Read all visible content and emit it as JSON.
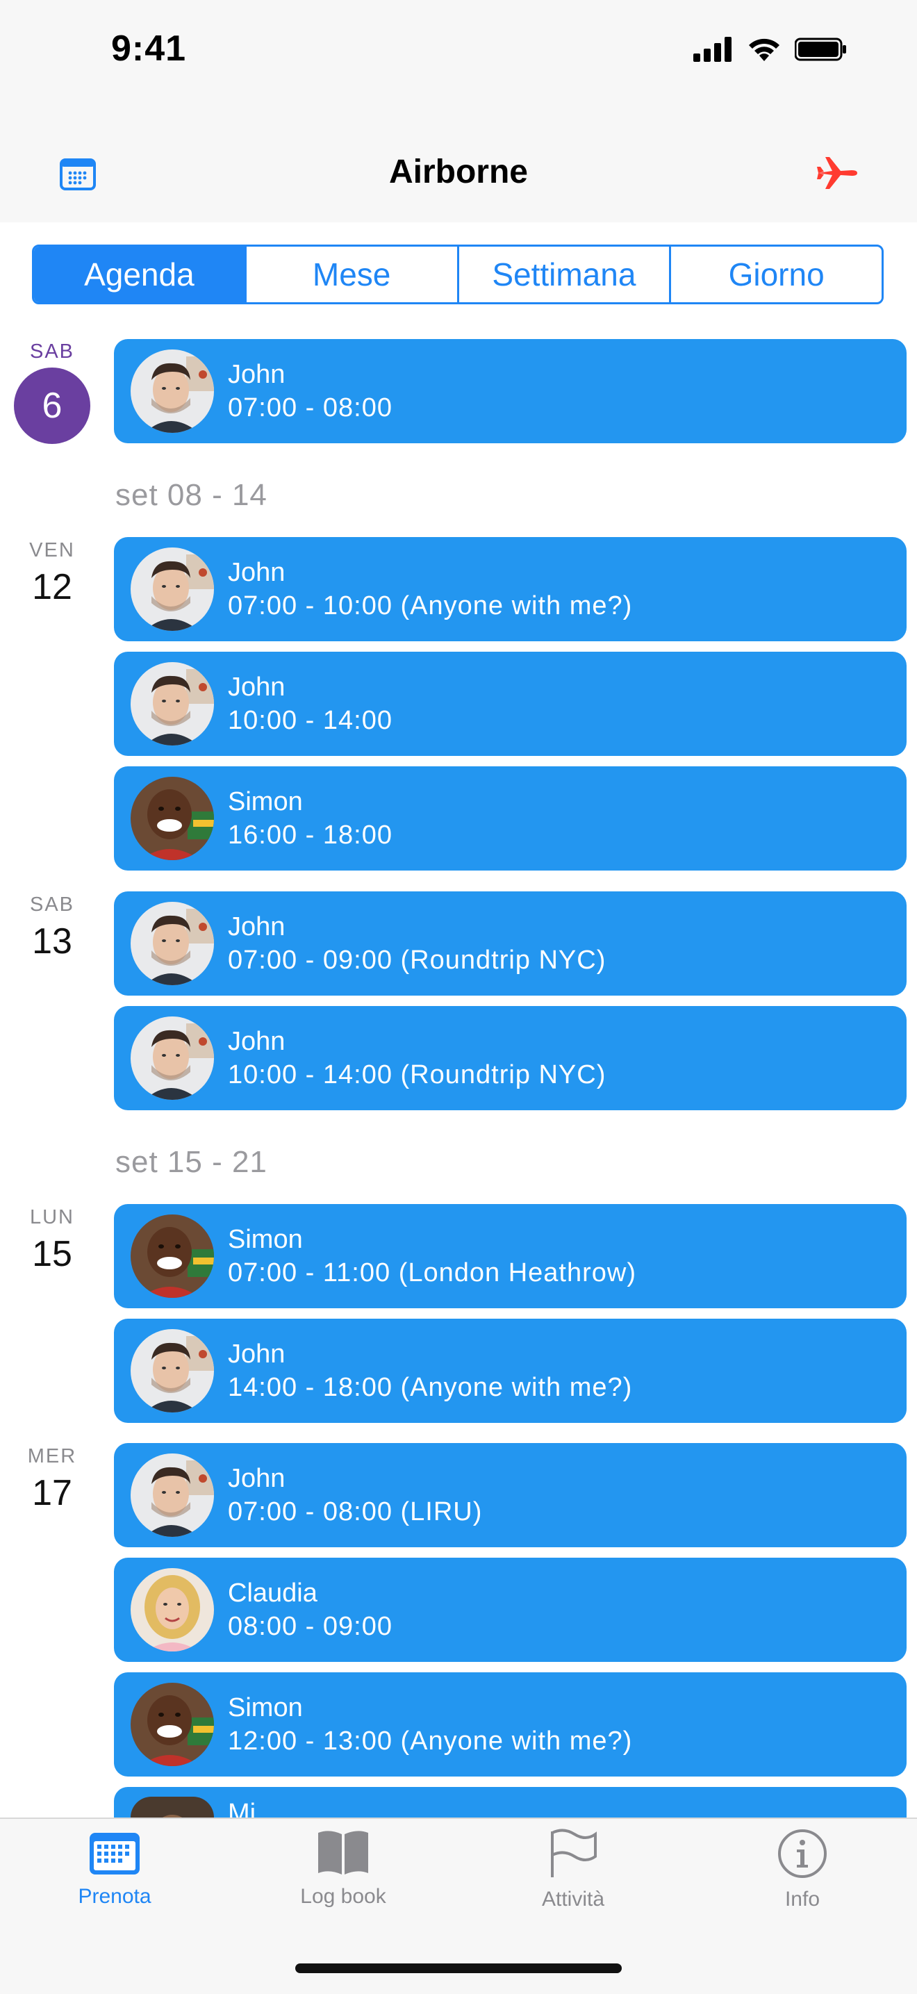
{
  "status_bar": {
    "time": "9:41"
  },
  "header": {
    "title": "Airborne",
    "left_icon": "calendar-icon",
    "right_icon": "airplane-icon"
  },
  "segments": [
    "Agenda",
    "Mese",
    "Settimana",
    "Giorno"
  ],
  "selected_segment": "Agenda",
  "colors": {
    "accent": "#1f86f5",
    "event": "#2396f0",
    "today": "#6a3fa0",
    "airplane": "#ff3b30"
  },
  "agenda": {
    "days": [
      {
        "dow": "SAB",
        "num": "6"
      },
      {
        "dow": "VEN",
        "num": "12"
      },
      {
        "dow": "SAB",
        "num": "13"
      },
      {
        "dow": "LUN",
        "num": "15"
      },
      {
        "dow": "MER",
        "num": "17"
      }
    ],
    "weeks": [
      "set 08 - 14",
      "set 15 - 21"
    ],
    "events": [
      {
        "name": "John",
        "time": "07:00 - 08:00"
      },
      {
        "name": "John",
        "time": "07:00 - 10:00 (Anyone with me?)"
      },
      {
        "name": "John",
        "time": "10:00 - 14:00"
      },
      {
        "name": "Simon",
        "time": "16:00 - 18:00"
      },
      {
        "name": "John",
        "time": "07:00 - 09:00 (Roundtrip NYC)"
      },
      {
        "name": "John",
        "time": "10:00 - 14:00 (Roundtrip NYC)"
      },
      {
        "name": "Simon",
        "time": "07:00 - 11:00 (London Heathrow)"
      },
      {
        "name": "John",
        "time": "14:00 - 18:00 (Anyone with me?)"
      },
      {
        "name": "John",
        "time": "07:00 - 08:00 (LIRU)"
      },
      {
        "name": "Claudia",
        "time": "08:00 - 09:00"
      },
      {
        "name": "Simon",
        "time": "12:00 - 13:00 (Anyone with me?)"
      },
      {
        "name": "Mi",
        "time": ""
      }
    ]
  },
  "tabs": [
    {
      "label": "Prenota",
      "icon": "calendar-grid-icon"
    },
    {
      "label": "Log book",
      "icon": "book-icon"
    },
    {
      "label": "Attività",
      "icon": "flag-icon"
    },
    {
      "label": "Info",
      "icon": "info-icon"
    }
  ],
  "active_tab": "Prenota"
}
